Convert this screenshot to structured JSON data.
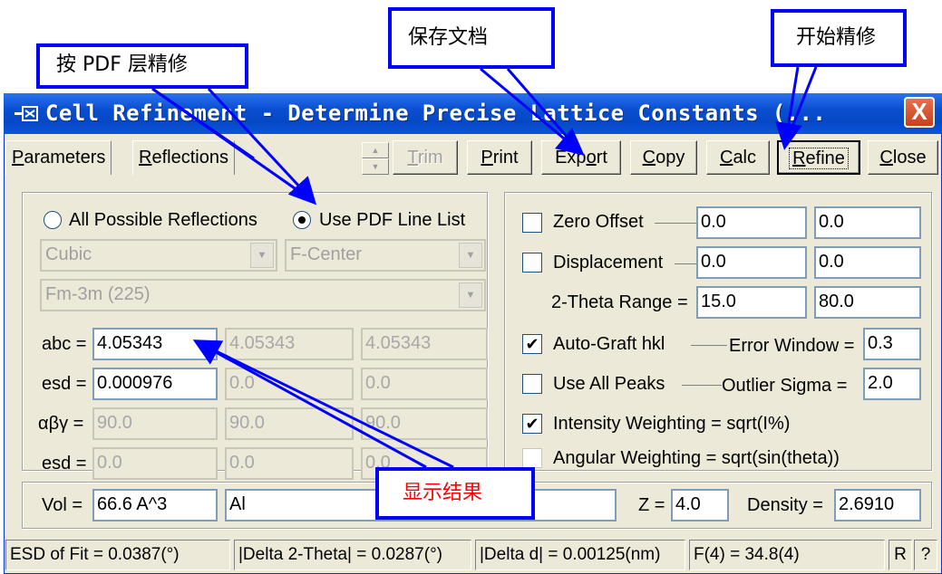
{
  "window": {
    "title": "Cell Refinement - Determine Precise Lattice Constants (...",
    "close_glyph": "X"
  },
  "tabs": [
    {
      "prefix": "",
      "mnemonic": "P",
      "rest": "arameters"
    },
    {
      "prefix": "",
      "mnemonic": "R",
      "rest": "eflections"
    }
  ],
  "toolbar": {
    "trim": {
      "mnemonic": "T",
      "rest": "rim"
    },
    "print": {
      "mnemonic": "P",
      "rest": "rint"
    },
    "export": {
      "pre": "Exp",
      "mnemonic": "o",
      "rest": "rt"
    },
    "copy": {
      "mnemonic": "C",
      "rest": "opy"
    },
    "calc": {
      "mnemonic": "C",
      "rest": "alc"
    },
    "refine": {
      "mnemonic": "R",
      "rest": "efine"
    },
    "close": {
      "mnemonic": "C",
      "rest": "lose"
    }
  },
  "left_panel": {
    "radio_all": "All Possible Reflections",
    "radio_pdf": "Use PDF Line List",
    "crystal_system": "Cubic",
    "centering": "F-Center",
    "space_group": "Fm-3m (225)",
    "abc_label": "abc =",
    "abc": [
      "4.05343",
      "4.05343",
      "4.05343"
    ],
    "esd_label": "esd =",
    "esd_abc": [
      "0.000976",
      "0.0",
      "0.0"
    ],
    "angles_label": "αβγ =",
    "angles": [
      "90.0",
      "90.0",
      "90.0"
    ],
    "esd_angles": [
      "0.0",
      "0.0",
      "0.0"
    ]
  },
  "right_panel": {
    "zero_offset": {
      "label": "Zero Offset",
      "v1": "0.0",
      "v2": "0.0",
      "checked": false
    },
    "displacement": {
      "label": "Displacement",
      "v1": "0.0",
      "v2": "0.0",
      "checked": false
    },
    "theta_range": {
      "label": "2-Theta Range =",
      "v1": "15.0",
      "v2": "80.0"
    },
    "auto_graft": {
      "label": "Auto-Graft hkl",
      "checked": true,
      "param_label": "Error Window =",
      "value": "0.3"
    },
    "use_all_peaks": {
      "label": "Use All Peaks",
      "checked": false,
      "param_label": "Outlier Sigma =",
      "value": "2.0"
    },
    "intensity_weighting": {
      "label": "Intensity Weighting = sqrt(I%)",
      "checked": true
    },
    "angular_weighting": {
      "label": "Angular Weighting = sqrt(sin(theta))",
      "checked": false
    }
  },
  "bottom_row": {
    "vol_label": "Vol =",
    "vol": "66.6 A^3",
    "phase": "Al",
    "z_label": "Z =",
    "z": "4.0",
    "density_label": "Density =",
    "density": "2.6910"
  },
  "status_bar": {
    "esd_fit": "ESD of Fit = 0.0387(°)",
    "delta_2theta": "|Delta 2-Theta| = 0.0287(°)",
    "delta_d": "|Delta d| = 0.00125(nm)",
    "fom": "F(4) = 34.8(4)",
    "r_button": "R",
    "help_button": "?"
  },
  "annotations": {
    "pdf_refine": "按 PDF 层精修",
    "save_doc": "保存文档",
    "start_refine": "开始精修",
    "show_result": "显示结果"
  },
  "colors": {
    "titlebar": "#0548c6",
    "callout_border": "#0000ff",
    "result_text": "#ff0000",
    "dialog_bg": "#ece9d8"
  }
}
